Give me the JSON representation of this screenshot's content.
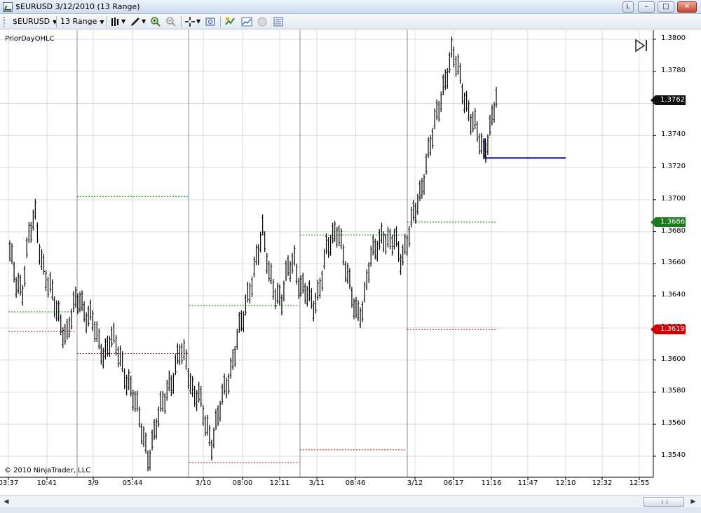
{
  "window": {
    "title": "$EURUSD  3/12/2010 (13 Range)",
    "buttons": [
      "L",
      "–",
      "□",
      "✕"
    ]
  },
  "toolbar": {
    "instrument": "$EURUSD",
    "interval": "13 Range",
    "icons": [
      "bar-type-icon",
      "draw-pencil-icon",
      "zoom-in-icon",
      "zoom-out-icon",
      "crosshair-icon",
      "snapshot-icon",
      "strategies-icon",
      "indicators-icon",
      "properties-icon",
      "data-box-icon"
    ]
  },
  "chart": {
    "indicator_label": "PriorDayOHLC",
    "copyright": "© 2010 NinjaTrader, LLC",
    "colors": {
      "candle": "#000000",
      "prior_high": "#008000",
      "prior_low": "#cc0000",
      "current_line": "#00008b",
      "grid": "#d9d9d9",
      "day_separator": "#8c8c8c"
    },
    "price_axis": {
      "ticks": [
        "1.3800",
        "1.3780",
        "1.3760",
        "1.3740",
        "1.3720",
        "1.3700",
        "1.3680",
        "1.3660",
        "1.3640",
        "1.3620",
        "1.3600",
        "1.3580",
        "1.3560",
        "1.3540"
      ],
      "badges": [
        {
          "label": "1.3762",
          "value": 1.3762,
          "color": "#111111"
        },
        {
          "label": "1.3686",
          "value": 1.3686,
          "color": "#1f7a1f"
        },
        {
          "label": "1.3619",
          "value": 1.3619,
          "color": "#d40000"
        }
      ]
    },
    "time_axis": [
      "03:37",
      "10:41",
      "3/9",
      "05:44",
      "3/10",
      "08:00",
      "12:11",
      "3/11",
      "08:46",
      "3/12",
      "06:17",
      "11:16",
      "11:47",
      "12:10",
      "12:32",
      "12:55"
    ]
  },
  "chart_data": {
    "type": "bar",
    "instrument": "$EURUSD",
    "interval": "13 Range",
    "ylim": [
      1.353,
      1.3805
    ],
    "grid": true,
    "price_series_approx": [
      1.3665,
      1.365,
      1.3645,
      1.3675,
      1.369,
      1.3665,
      1.3648,
      1.3635,
      1.3625,
      1.3615,
      1.363,
      1.364,
      1.363,
      1.3625,
      1.361,
      1.3605,
      1.3615,
      1.3605,
      1.3595,
      1.3585,
      1.357,
      1.3555,
      1.354,
      1.3555,
      1.357,
      1.3585,
      1.359,
      1.3605,
      1.36,
      1.358,
      1.3575,
      1.356,
      1.355,
      1.3565,
      1.358,
      1.3595,
      1.3615,
      1.3625,
      1.3645,
      1.3665,
      1.3678,
      1.3655,
      1.3645,
      1.3635,
      1.3655,
      1.3665,
      1.3645,
      1.364,
      1.3635,
      1.3645,
      1.3665,
      1.3675,
      1.3685,
      1.366,
      1.364,
      1.363,
      1.3635,
      1.366,
      1.3672,
      1.368,
      1.367,
      1.3675,
      1.3665,
      1.3675,
      1.369,
      1.3705,
      1.3725,
      1.374,
      1.376,
      1.3778,
      1.379,
      1.378,
      1.3765,
      1.375,
      1.374,
      1.373,
      1.3745,
      1.3762
    ],
    "prior_day_levels": [
      {
        "session": "3/9",
        "high": 1.3702,
        "low": 1.3604
      },
      {
        "session": "3/10",
        "high": 1.3634,
        "low": 1.3536
      },
      {
        "session": "3/11",
        "high": 1.3678,
        "low": 1.3544
      },
      {
        "session": "3/12",
        "high": 1.3686,
        "low": 1.3619
      }
    ],
    "first_session_levels": {
      "high": 1.363,
      "low": 1.3618
    },
    "current_level": 1.3726
  }
}
